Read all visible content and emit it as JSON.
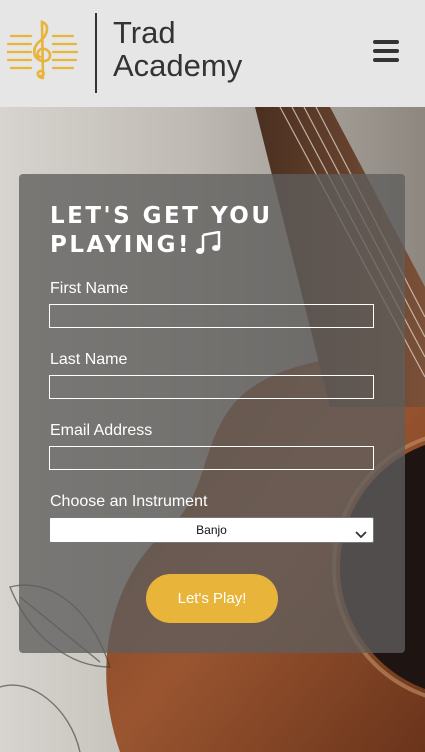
{
  "header": {
    "brand_line1": "Trad",
    "brand_line2": "Academy",
    "logo_icon": "treble-clef-icon",
    "menu_icon": "hamburger-menu-icon"
  },
  "form": {
    "title": "LET'S GET YOU PLAYING!",
    "title_icon": "music-note-icon",
    "first_name_label": "First Name",
    "last_name_label": "Last Name",
    "email_label": "Email Address",
    "instrument_label": "Choose an Instrument",
    "instrument_selected": "Banjo",
    "submit_label": "Let's Play!"
  },
  "colors": {
    "accent": "#e8b43a",
    "header_bg": "#e6e6e6",
    "text_dark": "#333333"
  }
}
